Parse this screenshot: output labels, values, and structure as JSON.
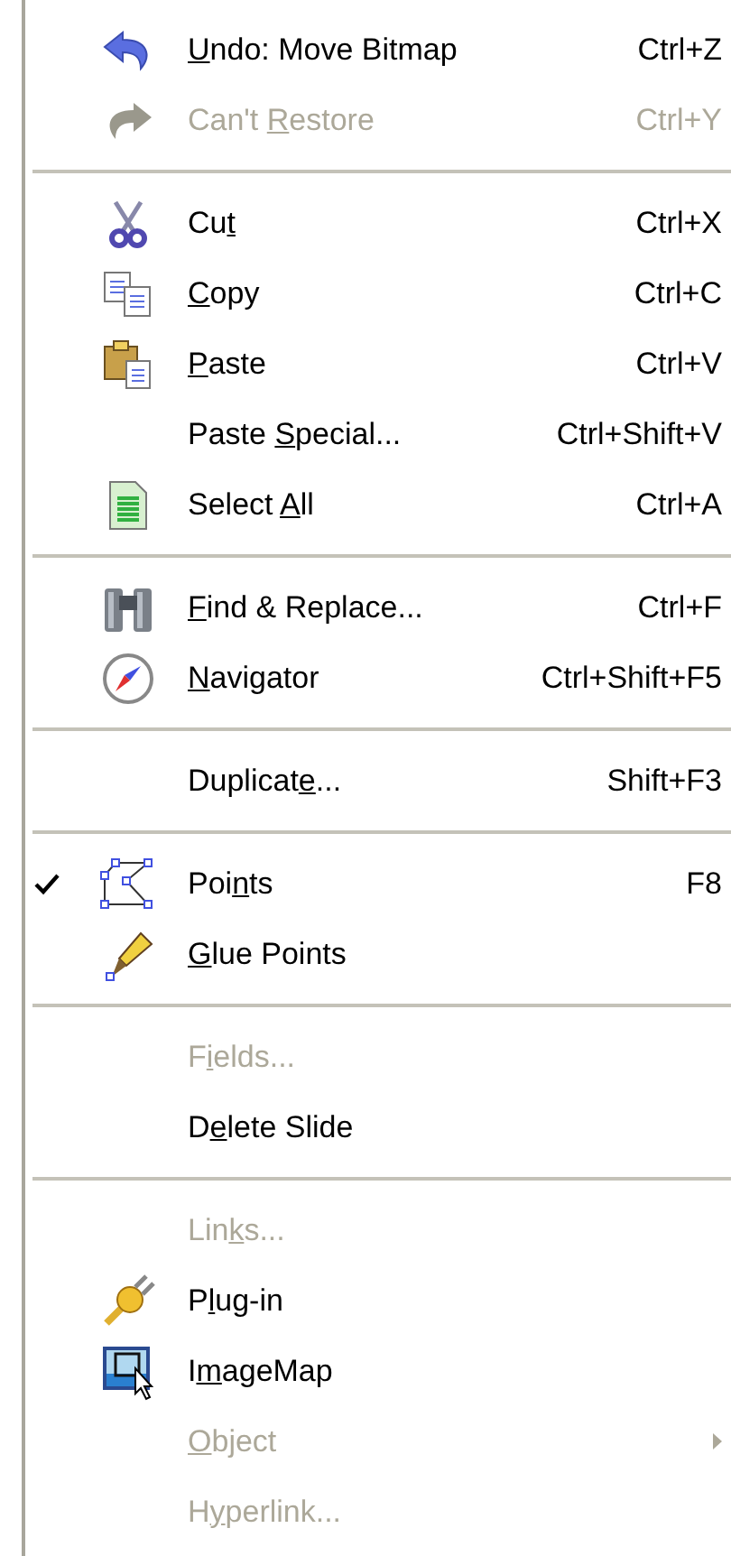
{
  "menu": {
    "items": [
      {
        "kind": "item",
        "label": {
          "key": "U",
          "after": "ndo: Move Bitmap"
        },
        "shortcut": "Ctrl+Z",
        "disabled": false,
        "checked": false,
        "submenu": false
      },
      {
        "kind": "item",
        "label": {
          "before": "Can't ",
          "key": "R",
          "after": "estore"
        },
        "shortcut": "Ctrl+Y",
        "disabled": true,
        "checked": false,
        "submenu": false
      },
      {
        "kind": "separator"
      },
      {
        "kind": "item",
        "label": {
          "before": "Cu",
          "key": "t"
        },
        "shortcut": "Ctrl+X",
        "disabled": false,
        "checked": false,
        "submenu": false
      },
      {
        "kind": "item",
        "label": {
          "key": "C",
          "after": "opy"
        },
        "shortcut": "Ctrl+C",
        "disabled": false,
        "checked": false,
        "submenu": false
      },
      {
        "kind": "item",
        "label": {
          "key": "P",
          "after": "aste"
        },
        "shortcut": "Ctrl+V",
        "disabled": false,
        "checked": false,
        "submenu": false
      },
      {
        "kind": "item",
        "label": {
          "before": "Paste ",
          "key": "S",
          "after": "pecial..."
        },
        "shortcut": "Ctrl+Shift+V",
        "disabled": false,
        "checked": false,
        "submenu": false
      },
      {
        "kind": "item",
        "label": {
          "before": "Select ",
          "key": "A",
          "after": "ll"
        },
        "shortcut": "Ctrl+A",
        "disabled": false,
        "checked": false,
        "submenu": false
      },
      {
        "kind": "separator"
      },
      {
        "kind": "item",
        "label": {
          "key": "F",
          "after": "ind & Replace..."
        },
        "shortcut": "Ctrl+F",
        "disabled": false,
        "checked": false,
        "submenu": false
      },
      {
        "kind": "item",
        "label": {
          "key": "N",
          "after": "avigator"
        },
        "shortcut": "Ctrl+Shift+F5",
        "disabled": false,
        "checked": false,
        "submenu": false
      },
      {
        "kind": "separator"
      },
      {
        "kind": "item",
        "label": {
          "before": "Duplicat",
          "key": "e",
          "after": "..."
        },
        "shortcut": "Shift+F3",
        "disabled": false,
        "checked": false,
        "submenu": false
      },
      {
        "kind": "separator"
      },
      {
        "kind": "item",
        "label": {
          "before": "Poi",
          "key": "n",
          "after": "ts"
        },
        "shortcut": "F8",
        "disabled": false,
        "checked": true,
        "submenu": false
      },
      {
        "kind": "item",
        "label": {
          "key": "G",
          "after": "lue Points"
        },
        "disabled": false,
        "checked": false,
        "submenu": false
      },
      {
        "kind": "separator"
      },
      {
        "kind": "item",
        "label": {
          "before": "F",
          "key": "i",
          "after": "elds..."
        },
        "disabled": true,
        "checked": false,
        "submenu": false
      },
      {
        "kind": "item",
        "label": {
          "before": "D",
          "key": "e",
          "after": "lete Slide"
        },
        "disabled": false,
        "checked": false,
        "submenu": false
      },
      {
        "kind": "separator"
      },
      {
        "kind": "item",
        "label": {
          "before": "Lin",
          "key": "k",
          "after": "s..."
        },
        "disabled": true,
        "checked": false,
        "submenu": false
      },
      {
        "kind": "item",
        "label": {
          "before": "P",
          "key": "l",
          "after": "ug-in"
        },
        "disabled": false,
        "checked": false,
        "submenu": false
      },
      {
        "kind": "item",
        "label": {
          "before": "I",
          "key": "m",
          "after": "ageMap"
        },
        "disabled": false,
        "checked": false,
        "submenu": false
      },
      {
        "kind": "item",
        "label": {
          "key": "O",
          "after": "bject"
        },
        "disabled": true,
        "checked": false,
        "submenu": true
      },
      {
        "kind": "item",
        "label": {
          "before": "H",
          "key": "y",
          "after": "perlink..."
        },
        "disabled": true,
        "checked": false,
        "submenu": false
      }
    ]
  }
}
